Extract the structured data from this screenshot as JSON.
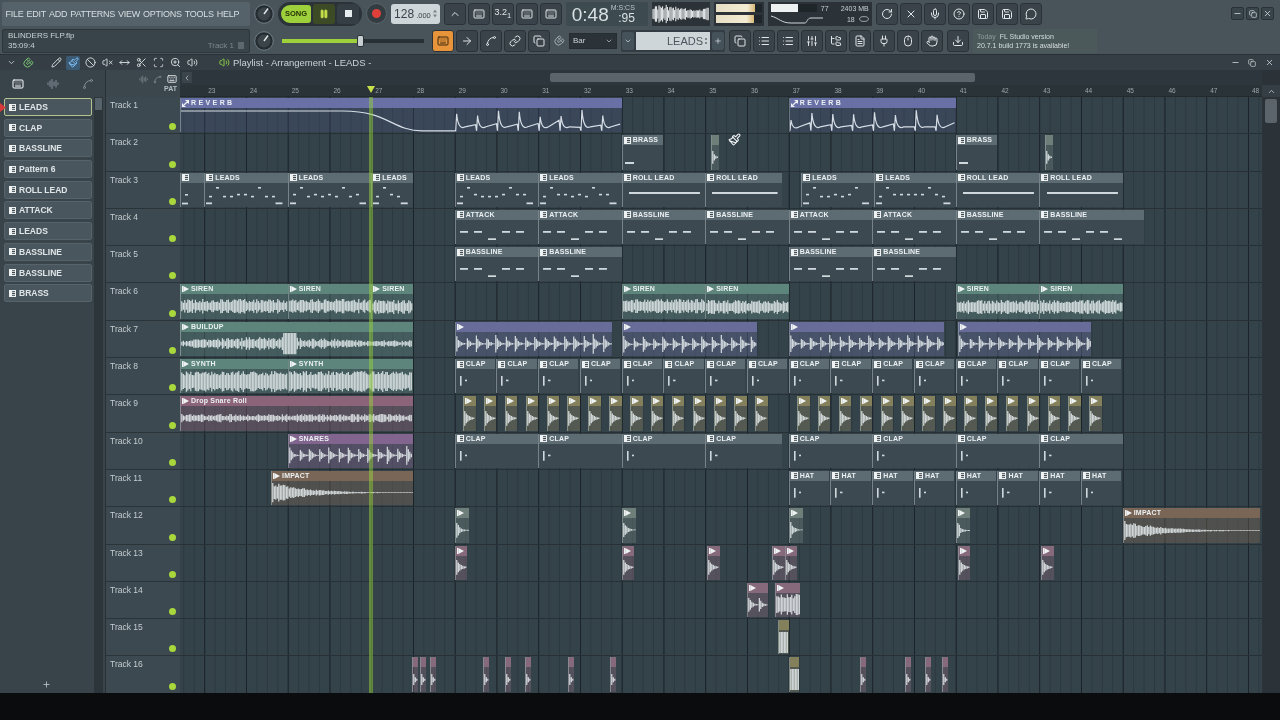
{
  "menu": [
    "FILE",
    "EDIT",
    "ADD",
    "PATTERNS",
    "VIEW",
    "OPTIONS",
    "TOOLS",
    "HELP"
  ],
  "project": {
    "file": "BLINDERS FLP.flp",
    "position": "35:09:4",
    "hint": "Track 1"
  },
  "transport": {
    "mode": "SONG",
    "song_mode": true,
    "playing": true
  },
  "tempo": {
    "value": "128",
    "fraction": ".000"
  },
  "countdown": "3.2$_{1}$",
  "time": {
    "unit": "M:S:CS",
    "value": "0:48",
    "fraction": ":95"
  },
  "master": {
    "volume": {
      "level": 0.55
    },
    "meters": [
      {
        "level": 0.86
      },
      {
        "level": 0.84
      }
    ]
  },
  "cpu": {
    "level": 0.6,
    "value": "77",
    "memory": "2403 MB",
    "polyphony": "18"
  },
  "view_buttons": [
    {
      "selected": true
    },
    {
      "selected": false
    },
    {
      "selected": false
    },
    {
      "selected": false
    },
    {
      "selected": false
    }
  ],
  "snap": {
    "value": "Bar"
  },
  "pattern_selector": {
    "value": "LEADS"
  },
  "news": {
    "date": "Today",
    "title": "FL Studio version",
    "body": "20.7.1 build 1773 is available!"
  },
  "playlist": {
    "title": "Playlist - Arrangement - LEADS -",
    "tools": [
      {
        "selected": false
      },
      {
        "selected": true
      },
      {
        "selected": false
      },
      {
        "selected": false
      },
      {
        "selected": false
      },
      {
        "selected": false
      },
      {
        "selected": false
      },
      {
        "selected": false
      },
      {
        "selected": false
      }
    ],
    "picker_tabs": [
      {
        "selected": true
      },
      {
        "selected": false
      },
      {
        "selected": false
      }
    ],
    "patterns": [
      {
        "label": "LEADS",
        "selected": true
      },
      {
        "label": "CLAP",
        "selected": false
      },
      {
        "label": "BASSLINE",
        "selected": false
      },
      {
        "label": "Pattern 6",
        "selected": false
      },
      {
        "label": "ROLL LEAD",
        "selected": false
      },
      {
        "label": "ATTACK",
        "selected": false
      },
      {
        "label": "LEADS",
        "selected": false
      },
      {
        "label": "BASSLINE",
        "selected": false
      },
      {
        "label": "BASSLINE",
        "selected": false
      },
      {
        "label": "BRASS",
        "selected": false
      }
    ],
    "header_label": "PAT",
    "ruler": [
      "23",
      "24",
      "25",
      "26",
      "27",
      "28",
      "29",
      "30",
      "31",
      "32",
      "33",
      "34",
      "35",
      "36",
      "37",
      "38",
      "39",
      "40",
      "41",
      "42",
      "43",
      "44",
      "45",
      "46",
      "47",
      "48"
    ],
    "tracks": [
      {
        "name": "Track 1",
        "enabled": true,
        "clips": [
          {
            "kind": "automation",
            "label": "REVERB"
          },
          {
            "kind": "automation",
            "label": "REVERB"
          }
        ]
      },
      {
        "name": "Track 2",
        "enabled": true,
        "clips": [
          {
            "kind": "pattern",
            "label": "BRASS"
          },
          {
            "kind": "audio",
            "color": "#6e7f7a"
          },
          {
            "kind": "pattern",
            "label": "BRASS"
          },
          {
            "kind": "audio",
            "color": "#6e7f7a"
          }
        ]
      },
      {
        "name": "Track 3",
        "enabled": true,
        "clips": [
          {
            "kind": "pattern"
          },
          {
            "kind": "pattern",
            "label": "LEADS"
          },
          {
            "kind": "pattern",
            "label": "LEADS"
          },
          {
            "kind": "pattern",
            "label": "LEADS"
          },
          {
            "kind": "pattern",
            "label": "LEADS"
          },
          {
            "kind": "pattern",
            "label": "LEADS"
          },
          {
            "kind": "pattern",
            "label": "ROLL LEAD"
          },
          {
            "kind": "pattern",
            "label": "ROLL LEAD"
          },
          {
            "kind": "pattern",
            "label": "LEADS"
          },
          {
            "kind": "pattern",
            "label": "LEADS"
          },
          {
            "kind": "pattern",
            "label": "ROLL LEAD"
          },
          {
            "kind": "pattern",
            "label": "ROLL LEAD"
          }
        ]
      },
      {
        "name": "Track 4",
        "enabled": true,
        "clips": [
          {
            "kind": "pattern",
            "label": "ATTACK"
          },
          {
            "kind": "pattern",
            "label": "ATTACK"
          },
          {
            "kind": "pattern",
            "label": "BASSLINE"
          },
          {
            "kind": "pattern",
            "label": "BASSLINE"
          },
          {
            "kind": "pattern",
            "label": "ATTACK"
          },
          {
            "kind": "pattern",
            "label": "ATTACK"
          },
          {
            "kind": "pattern",
            "label": "BASSLINE"
          },
          {
            "kind": "pattern",
            "label": "BASSLINE"
          }
        ]
      },
      {
        "name": "Track 5",
        "enabled": true,
        "clips": [
          {
            "kind": "pattern",
            "label": "BASSLINE"
          },
          {
            "kind": "pattern",
            "label": "BASSLINE"
          },
          {
            "kind": "pattern",
            "label": "BASSLINE"
          },
          {
            "kind": "pattern",
            "label": "BASSLINE"
          }
        ]
      },
      {
        "name": "Track 6",
        "enabled": true,
        "clips": [
          {
            "kind": "audio",
            "label": "SIREN",
            "color": "#5d857b"
          },
          {
            "kind": "audio",
            "label": "SIREN",
            "color": "#5d857b"
          },
          {
            "kind": "audio",
            "label": "SIREN",
            "color": "#5d857b"
          },
          {
            "kind": "audio",
            "label": "SIREN",
            "color": "#5d857b"
          },
          {
            "kind": "audio",
            "label": "SIREN",
            "color": "#5d857b"
          },
          {
            "kind": "audio",
            "label": "SIREN",
            "color": "#5d857b"
          },
          {
            "kind": "audio",
            "label": "SIREN",
            "color": "#5d857b"
          }
        ]
      },
      {
        "name": "Track 7",
        "enabled": true,
        "clips": [
          {
            "kind": "audio",
            "label": "BUILDUP",
            "color": "#5d857b"
          },
          {
            "kind": "audio",
            "color": "#676d98"
          },
          {
            "kind": "audio",
            "color": "#676d98"
          },
          {
            "kind": "audio",
            "color": "#676d98"
          },
          {
            "kind": "audio",
            "color": "#676d98"
          }
        ]
      },
      {
        "name": "Track 8",
        "enabled": true,
        "clips": [
          {
            "kind": "audio",
            "label": "SYNTH",
            "color": "#5d857b"
          },
          {
            "kind": "audio",
            "label": "SYNTH",
            "color": "#5d857b"
          },
          {
            "kind": "pattern",
            "label": "CLAP"
          },
          {
            "kind": "pattern",
            "label": "CLAP"
          },
          {
            "kind": "pattern",
            "label": "CLAP"
          },
          {
            "kind": "pattern",
            "label": "CLAP"
          },
          {
            "kind": "pattern",
            "label": "CLAP"
          },
          {
            "kind": "pattern",
            "label": "CLAP"
          },
          {
            "kind": "pattern",
            "label": "CLAP"
          },
          {
            "kind": "pattern",
            "label": "CLAP"
          },
          {
            "kind": "pattern",
            "label": "CLAP"
          },
          {
            "kind": "pattern",
            "label": "CLAP"
          },
          {
            "kind": "pattern",
            "label": "CLAP"
          },
          {
            "kind": "pattern",
            "label": "CLAP"
          },
          {
            "kind": "pattern",
            "label": "CLAP"
          },
          {
            "kind": "pattern",
            "label": "CLAP"
          },
          {
            "kind": "pattern",
            "label": "CLAP"
          },
          {
            "kind": "pattern",
            "label": "CLAP"
          }
        ]
      },
      {
        "name": "Track 9",
        "enabled": true,
        "clips": [
          {
            "kind": "audio",
            "label": "Drop Snare Roll",
            "color": "#8b6479"
          },
          {
            "kind": "audio",
            "color": "#84805c"
          },
          {
            "kind": "audio",
            "color": "#84805c"
          },
          {
            "kind": "audio",
            "color": "#84805c"
          },
          {
            "kind": "audio",
            "color": "#84805c"
          },
          {
            "kind": "audio",
            "color": "#84805c"
          },
          {
            "kind": "audio",
            "color": "#84805c"
          },
          {
            "kind": "audio",
            "color": "#84805c"
          },
          {
            "kind": "audio",
            "color": "#84805c"
          },
          {
            "kind": "audio",
            "color": "#84805c"
          },
          {
            "kind": "audio",
            "color": "#84805c"
          },
          {
            "kind": "audio",
            "color": "#84805c"
          },
          {
            "kind": "audio",
            "color": "#84805c"
          },
          {
            "kind": "audio",
            "color": "#84805c"
          },
          {
            "kind": "audio",
            "color": "#84805c"
          },
          {
            "kind": "audio",
            "color": "#84805c"
          },
          {
            "kind": "audio",
            "color": "#84805c"
          },
          {
            "kind": "audio",
            "color": "#84805c"
          },
          {
            "kind": "audio",
            "color": "#84805c"
          },
          {
            "kind": "audio",
            "color": "#84805c"
          },
          {
            "kind": "audio",
            "color": "#84805c"
          },
          {
            "kind": "audio",
            "color": "#84805c"
          },
          {
            "kind": "audio",
            "color": "#84805c"
          },
          {
            "kind": "audio",
            "color": "#84805c"
          },
          {
            "kind": "audio",
            "color": "#84805c"
          },
          {
            "kind": "audio",
            "color": "#84805c"
          },
          {
            "kind": "audio",
            "color": "#84805c"
          },
          {
            "kind": "audio",
            "color": "#84805c"
          },
          {
            "kind": "audio",
            "color": "#84805c"
          },
          {
            "kind": "audio",
            "color": "#84805c"
          },
          {
            "kind": "audio",
            "color": "#84805c"
          }
        ]
      },
      {
        "name": "Track 10",
        "enabled": true,
        "clips": [
          {
            "kind": "audio",
            "label": "SNARES",
            "color": "#82658f"
          },
          {
            "kind": "pattern",
            "label": "CLAP"
          },
          {
            "kind": "pattern",
            "label": "CLAP"
          },
          {
            "kind": "pattern",
            "label": "CLAP"
          },
          {
            "kind": "pattern",
            "label": "CLAP"
          },
          {
            "kind": "pattern",
            "label": "CLAP"
          },
          {
            "kind": "pattern",
            "label": "CLAP"
          },
          {
            "kind": "pattern",
            "label": "CLAP"
          },
          {
            "kind": "pattern",
            "label": "CLAP"
          }
        ]
      },
      {
        "name": "Track 11",
        "enabled": true,
        "clips": [
          {
            "kind": "audio",
            "label": "IMPACT",
            "color": "#7a6656"
          },
          {
            "kind": "pattern",
            "label": "HAT"
          },
          {
            "kind": "pattern",
            "label": "HAT"
          },
          {
            "kind": "pattern",
            "label": "HAT"
          },
          {
            "kind": "pattern",
            "label": "HAT"
          },
          {
            "kind": "pattern",
            "label": "HAT"
          },
          {
            "kind": "pattern",
            "label": "HAT"
          },
          {
            "kind": "pattern",
            "label": "HAT"
          },
          {
            "kind": "pattern",
            "label": "HAT"
          }
        ]
      },
      {
        "name": "Track 12",
        "enabled": true,
        "clips": [
          {
            "kind": "audio",
            "color": "#6e7f7a"
          },
          {
            "kind": "audio",
            "color": "#6e7f7a"
          },
          {
            "kind": "audio",
            "color": "#6e7f7a"
          },
          {
            "kind": "audio",
            "color": "#6e7f7a"
          },
          {
            "kind": "audio",
            "label": "IMPACT",
            "color": "#7a6656"
          }
        ]
      },
      {
        "name": "Track 13",
        "enabled": true,
        "clips": [
          {
            "kind": "audio",
            "color": "#86697a"
          },
          {
            "kind": "audio",
            "color": "#86697a"
          },
          {
            "kind": "audio",
            "color": "#86697a"
          },
          {
            "kind": "audio",
            "color": "#86697a"
          },
          {
            "kind": "audio",
            "color": "#86697a"
          },
          {
            "kind": "audio",
            "color": "#86697a"
          },
          {
            "kind": "audio",
            "color": "#86697a"
          }
        ]
      },
      {
        "name": "Track 14",
        "enabled": true,
        "clips": [
          {
            "kind": "audio",
            "color": "#86697a"
          },
          {
            "kind": "audio",
            "color": "#86697a"
          }
        ]
      },
      {
        "name": "Track 15",
        "enabled": true,
        "clips": [
          {
            "kind": "audio",
            "color": "#84805c"
          }
        ]
      },
      {
        "name": "Track 16",
        "enabled": true,
        "clips": [
          {
            "kind": "audio",
            "color": "#86697a"
          },
          {
            "kind": "audio",
            "color": "#86697a"
          },
          {
            "kind": "audio",
            "color": "#86697a"
          },
          {
            "kind": "audio",
            "color": "#86697a"
          },
          {
            "kind": "audio",
            "color": "#86697a"
          },
          {
            "kind": "audio",
            "color": "#86697a"
          },
          {
            "kind": "audio",
            "color": "#86697a"
          },
          {
            "kind": "audio",
            "color": "#86697a"
          },
          {
            "kind": "audio",
            "color": "#84805c"
          },
          {
            "kind": "audio",
            "color": "#86697a"
          },
          {
            "kind": "audio",
            "color": "#86697a"
          },
          {
            "kind": "audio",
            "color": "#86697a"
          },
          {
            "kind": "audio",
            "color": "#86697a"
          }
        ]
      }
    ]
  }
}
